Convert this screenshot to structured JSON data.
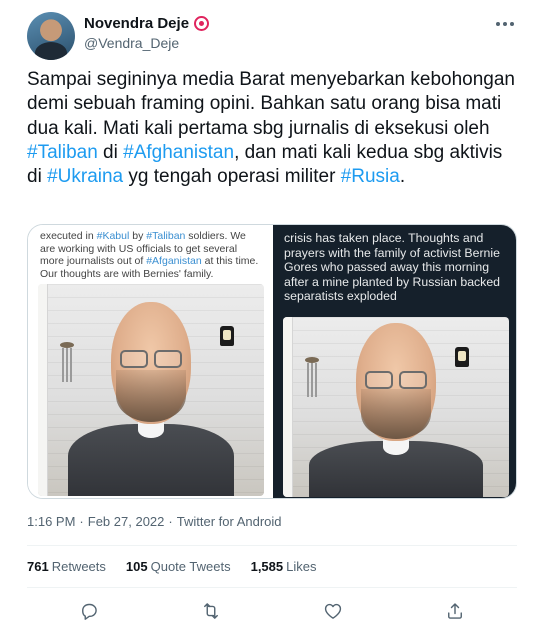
{
  "author": {
    "display_name": "Novendra Deje",
    "handle": "@Vendra_Deje",
    "avatar_icon": "user-avatar",
    "badge_icon": "flower-badge-icon"
  },
  "tweet": {
    "segments": [
      {
        "text": "Sampai segininya media Barat menyebarkan kebohongan demi sebuah framing opini. Bahkan satu orang bisa mati dua kali. Mati kali pertama sbg jurnalis di eksekusi oleh ",
        "hashtag": false
      },
      {
        "text": "#Taliban",
        "hashtag": true
      },
      {
        "text": " di ",
        "hashtag": false
      },
      {
        "text": "#Afghanistan",
        "hashtag": true
      },
      {
        "text": ", dan mati kali kedua sbg aktivis di ",
        "hashtag": false
      },
      {
        "text": "#Ukraina",
        "hashtag": true
      },
      {
        "text": " yg tengah operasi militer ",
        "hashtag": false
      },
      {
        "text": "#Rusia",
        "hashtag": true
      },
      {
        "text": ".",
        "hashtag": false
      }
    ]
  },
  "media": {
    "left": {
      "caption_segments": [
        {
          "text": "executed in ",
          "tag": false
        },
        {
          "text": "#Kabul",
          "tag": true
        },
        {
          "text": " by ",
          "tag": false
        },
        {
          "text": "#Taliban",
          "tag": true
        },
        {
          "text": " soldiers. We are working with US officials to get several more journalists out of ",
          "tag": false
        },
        {
          "text": "#Afganistan",
          "tag": true
        },
        {
          "text": " at this time. Our thoughts are with Bernies' family.",
          "tag": false
        }
      ]
    },
    "right": {
      "caption": "crisis has taken place. Thoughts and prayers with the family of activist Bernie Gores who passed away this morning after a mine planted by Russian backed separatists exploded"
    }
  },
  "meta": {
    "time": "1:16 PM",
    "separator": "·",
    "date": "Feb 27, 2022",
    "source": "Twitter for Android"
  },
  "stats": {
    "retweets_count": "761",
    "retweets_label": "Retweets",
    "quotes_count": "105",
    "quotes_label": "Quote Tweets",
    "likes_count": "1,585",
    "likes_label": "Likes"
  },
  "actions": {
    "reply_icon": "reply-icon",
    "retweet_icon": "retweet-icon",
    "like_icon": "heart-icon",
    "share_icon": "share-icon"
  },
  "colors": {
    "link": "#1d9bf0",
    "text": "#0f1419",
    "muted": "#536471",
    "badge": "#e0245e"
  }
}
